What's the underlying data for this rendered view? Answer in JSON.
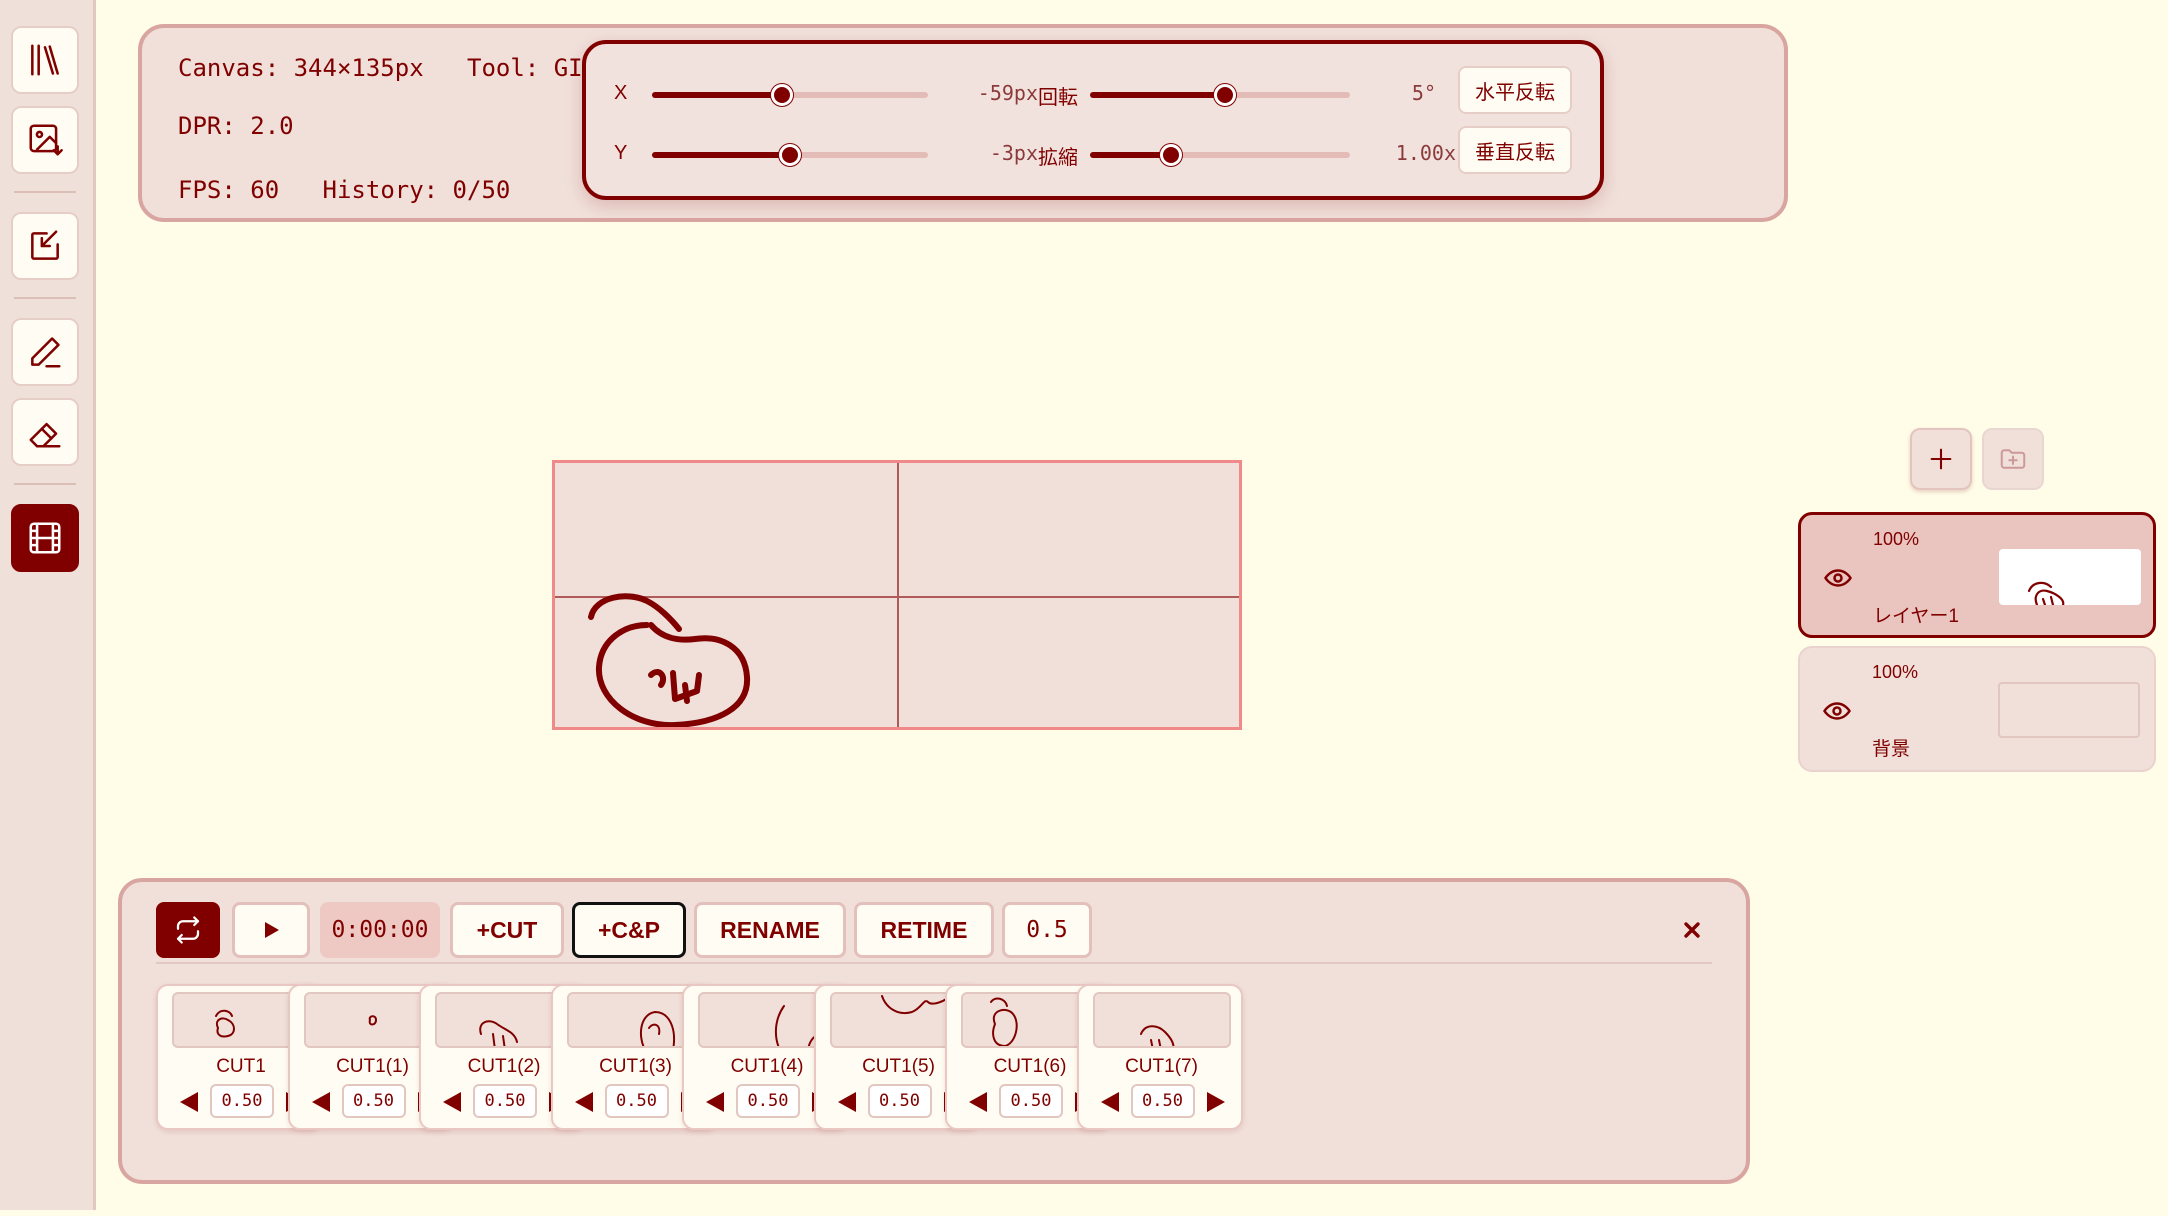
{
  "toolbar": {
    "tools": [
      {
        "name": "library-icon"
      },
      {
        "name": "import-image-icon"
      },
      {
        "name": "export-icon"
      },
      {
        "name": "pen-icon"
      },
      {
        "name": "eraser-icon"
      },
      {
        "name": "film-icon",
        "active": true
      }
    ]
  },
  "info": {
    "canvas": "Canvas: 344×135px",
    "tool": "Tool: GIFアニ",
    "dpr": "DPR: 2.0",
    "fps": "FPS: 60",
    "history": "History: 0/50"
  },
  "transform": {
    "x": {
      "label": "X",
      "value": "-59px",
      "level": 0.47
    },
    "y": {
      "label": "Y",
      "value": "-3px",
      "level": 0.5
    },
    "rotate": {
      "label": "回転",
      "value": "5°",
      "level": 0.52
    },
    "scale": {
      "label": "拡縮",
      "value": "1.00x",
      "level": 0.31
    },
    "flip_h": "水平反転",
    "flip_v": "垂直反転"
  },
  "layers": {
    "add_icon": "plus-icon",
    "folder_icon": "add-folder-icon",
    "items": [
      {
        "opacity": "100%",
        "name": "レイヤー1",
        "active": true
      },
      {
        "opacity": "100%",
        "name": "背景",
        "active": false
      }
    ]
  },
  "timeline": {
    "loop_icon": "loop-icon",
    "play_icon": "play-icon",
    "time": "0:00:00",
    "add_cut": "+CUT",
    "copy_paste": "+C&P",
    "rename": "RENAME",
    "retime": "RETIME",
    "duration": "0.5",
    "close_icon": "close-icon",
    "cuts": [
      {
        "name": "CUT1",
        "duration": "0.50"
      },
      {
        "name": "CUT1(1)",
        "duration": "0.50"
      },
      {
        "name": "CUT1(2)",
        "duration": "0.50"
      },
      {
        "name": "CUT1(3)",
        "duration": "0.50"
      },
      {
        "name": "CUT1(4)",
        "duration": "0.50"
      },
      {
        "name": "CUT1(5)",
        "duration": "0.50"
      },
      {
        "name": "CUT1(6)",
        "duration": "0.50"
      },
      {
        "name": "CUT1(7)",
        "duration": "0.50"
      }
    ]
  },
  "colors": {
    "accent": "#800000",
    "background": "#fffde8",
    "panel": "#f1e0da",
    "canvas_border": "#f08a8a"
  }
}
